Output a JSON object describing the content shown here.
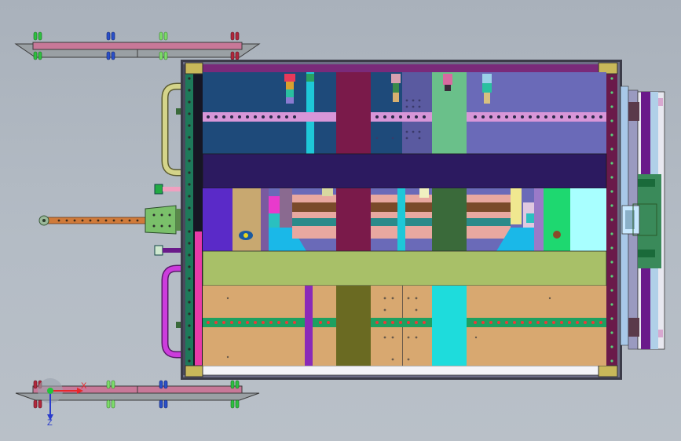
{
  "viewport": {
    "axis_x_label": "X",
    "axis_z_label": "Z"
  },
  "colors": {
    "background": "#b1b9c2",
    "frame": "#3b3b48",
    "axis_x": "#e8262a",
    "axis_z": "#2a3ccc",
    "axis_origin": "#22c43a"
  },
  "icons": {
    "axis_triad": "axis-triad-icon"
  }
}
